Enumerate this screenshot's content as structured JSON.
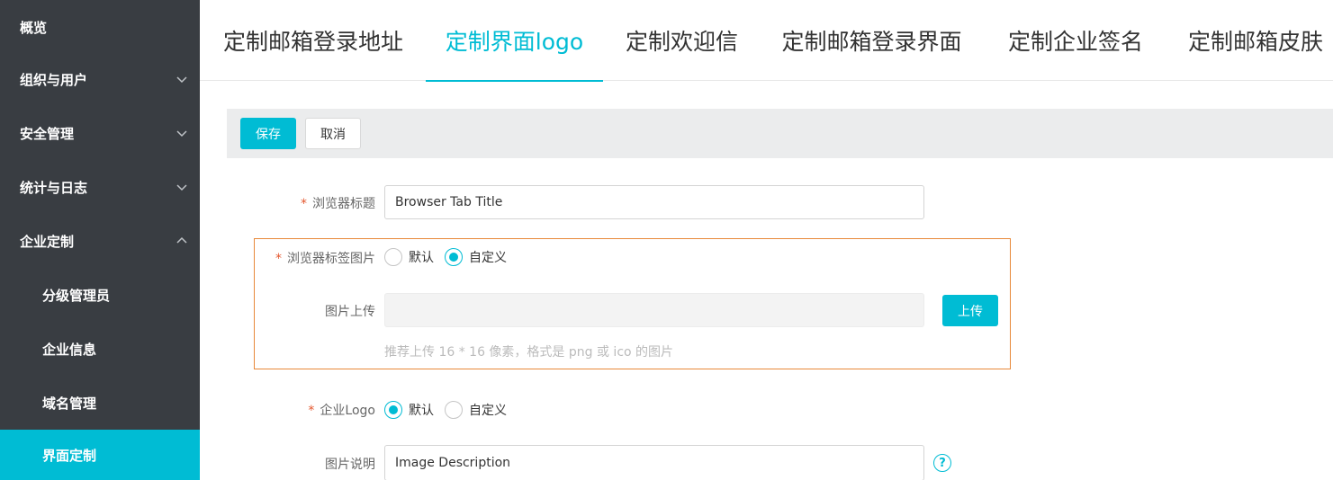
{
  "sidebar": {
    "items": [
      {
        "label": "概览"
      },
      {
        "label": "组织与用户"
      },
      {
        "label": "安全管理"
      },
      {
        "label": "统计与日志"
      },
      {
        "label": "企业定制"
      },
      {
        "label": "分级管理员"
      },
      {
        "label": "企业信息"
      },
      {
        "label": "域名管理"
      },
      {
        "label": "界面定制"
      }
    ],
    "active_color": "#00bcd4",
    "background": "#393d42"
  },
  "tabs": [
    {
      "label": "定制邮箱登录地址"
    },
    {
      "label": "定制界面logo"
    },
    {
      "label": "定制欢迎信"
    },
    {
      "label": "定制邮箱登录界面"
    },
    {
      "label": "定制企业签名"
    },
    {
      "label": "定制邮箱皮肤"
    }
  ],
  "active_tab": "定制界面logo",
  "toolbar": {
    "save_label": "保存",
    "cancel_label": "取消"
  },
  "form": {
    "browser_title": {
      "required_mark": "*",
      "label": "浏览器标题",
      "value": "Browser Tab Title"
    },
    "tab_icon": {
      "required_mark": "*",
      "label": "浏览器标签图片",
      "options": [
        "默认",
        "自定义"
      ],
      "selected": "自定义",
      "upload_label": "图片上传",
      "upload_button": "上传",
      "hint": "推荐上传 16 * 16 像素，格式是 png 或 ico 的图片"
    },
    "enterprise_logo": {
      "required_mark": "*",
      "label": "企业Logo",
      "options": [
        "默认",
        "自定义"
      ],
      "selected": "默认"
    },
    "image_desc": {
      "label": "图片说明",
      "value": "Image Description",
      "help_icon": "question-circle-icon",
      "help_glyph": "?"
    }
  },
  "colors": {
    "accent": "#00bcd4",
    "highlight_border": "#e8893a",
    "required": "#e4572e"
  }
}
